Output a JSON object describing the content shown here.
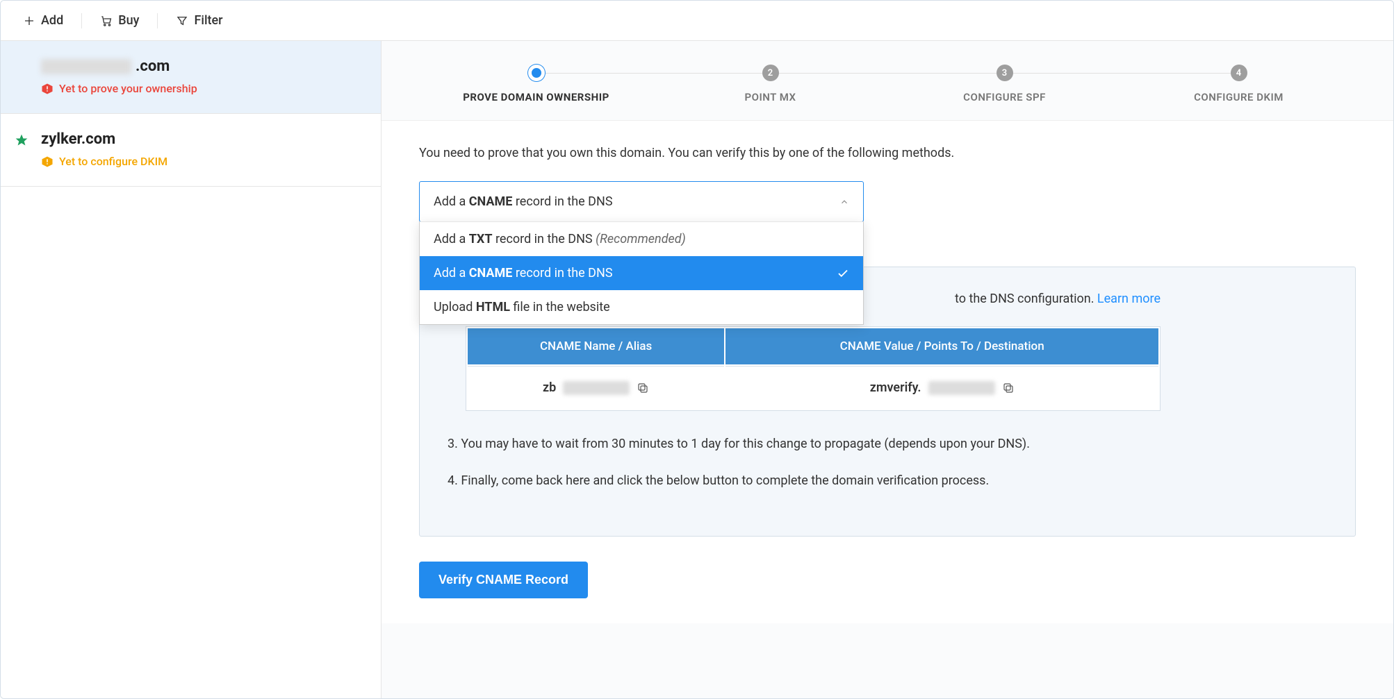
{
  "toolbar": {
    "add": "Add",
    "buy": "Buy",
    "filter": "Filter"
  },
  "sidebar": {
    "domains": [
      {
        "name_suffix": ".com",
        "status": "Yet to prove your ownership",
        "status_color": "red",
        "starred": false
      },
      {
        "name": "zylker.com",
        "status": "Yet to configure DKIM",
        "status_color": "orange",
        "starred": true
      }
    ]
  },
  "steps": [
    {
      "num": "",
      "label": "PROVE DOMAIN OWNERSHIP",
      "active": true
    },
    {
      "num": "2",
      "label": "POINT MX",
      "active": false
    },
    {
      "num": "3",
      "label": "CONFIGURE SPF",
      "active": false
    },
    {
      "num": "4",
      "label": "CONFIGURE DKIM",
      "active": false
    }
  ],
  "intro": "You need to prove that you own this domain. You can verify this by one of the following methods.",
  "select": {
    "prefix": "Add a ",
    "strong": "CNAME",
    "suffix": " record in the DNS"
  },
  "dropdown": [
    {
      "prefix": "Add a ",
      "strong": "TXT",
      "suffix": " record in the DNS ",
      "rec": "(Recommended)",
      "selected": false
    },
    {
      "prefix": "Add a ",
      "strong": "CNAME",
      "suffix": " record in the DNS",
      "selected": true
    },
    {
      "prefix": "Upload ",
      "strong": "HTML",
      "suffix": " file in the website",
      "selected": false
    }
  ],
  "card": {
    "step2_partial": "to the DNS configuration. ",
    "learn_more": "Learn more",
    "table": {
      "headers": [
        "CNAME Name / Alias",
        "CNAME Value / Points To / Destination"
      ],
      "values": [
        "zb",
        "zmverify."
      ]
    },
    "step3": "3. You may have to wait from 30 minutes to 1 day for this change to propagate (depends upon your DNS).",
    "step4": "4. Finally, come back here and click the below button to complete the domain verification process."
  },
  "verify_button": "Verify CNAME Record"
}
